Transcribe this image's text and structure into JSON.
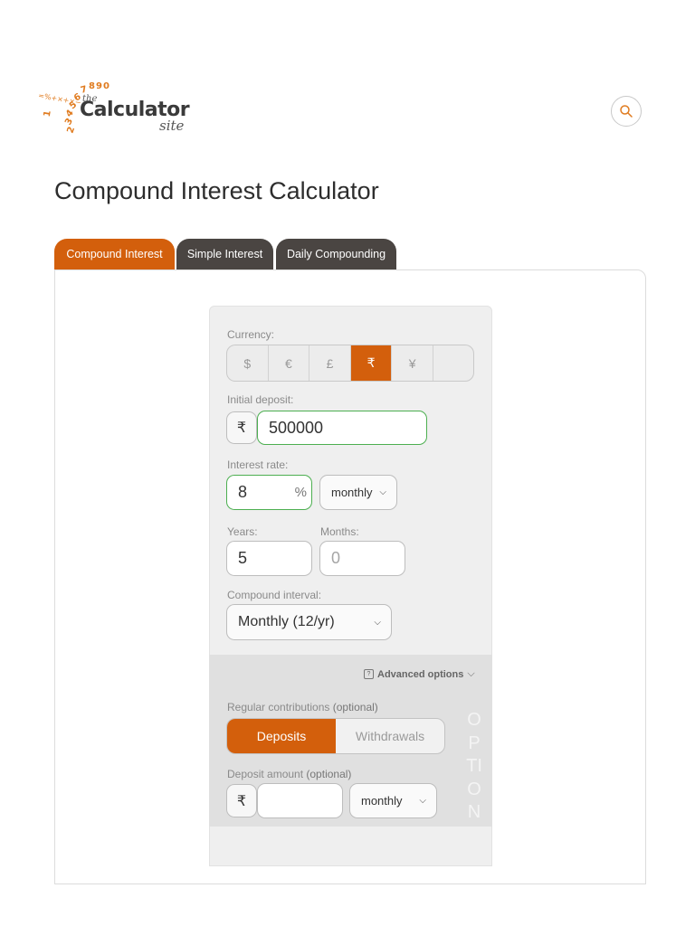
{
  "logo": {
    "digits": "1234567890",
    "symbols": "÷×+−%=",
    "the": "the",
    "name": "Calculator",
    "site": "site"
  },
  "page_title": "Compound Interest Calculator",
  "tabs": [
    {
      "label": "Compound Interest",
      "active": true
    },
    {
      "label": "Simple Interest",
      "active": false
    },
    {
      "label": "Daily Compounding",
      "active": false
    }
  ],
  "currency": {
    "label": "Currency:",
    "options": [
      "$",
      "€",
      "£",
      "₹",
      "¥",
      ""
    ],
    "selected": "₹"
  },
  "initial_deposit": {
    "label": "Initial deposit:",
    "prefix": "₹",
    "value": "500000"
  },
  "interest_rate": {
    "label": "Interest rate:",
    "value": "8",
    "suffix": "%",
    "period": "monthly"
  },
  "years": {
    "label": "Years:",
    "value": "5"
  },
  "months": {
    "label": "Months:",
    "placeholder": "0"
  },
  "compound_interval": {
    "label": "Compound interval:",
    "value": "Monthly (12/yr)"
  },
  "advanced": {
    "label": "Advanced options",
    "help": "?",
    "chevron": "⌵"
  },
  "contributions": {
    "label": "Regular contributions",
    "optional": "(optional)",
    "deposits": "Deposits",
    "withdrawals": "Withdrawals"
  },
  "deposit_amount": {
    "label": "Deposit amount",
    "optional": "(optional)",
    "prefix": "₹",
    "frequency": "monthly"
  },
  "vertical_text": "OPTION",
  "colors": {
    "accent": "#d35f0c",
    "tab_dark": "#4a4542"
  },
  "icons": {
    "search": "search-icon",
    "chevron": "chevron-down-icon"
  }
}
